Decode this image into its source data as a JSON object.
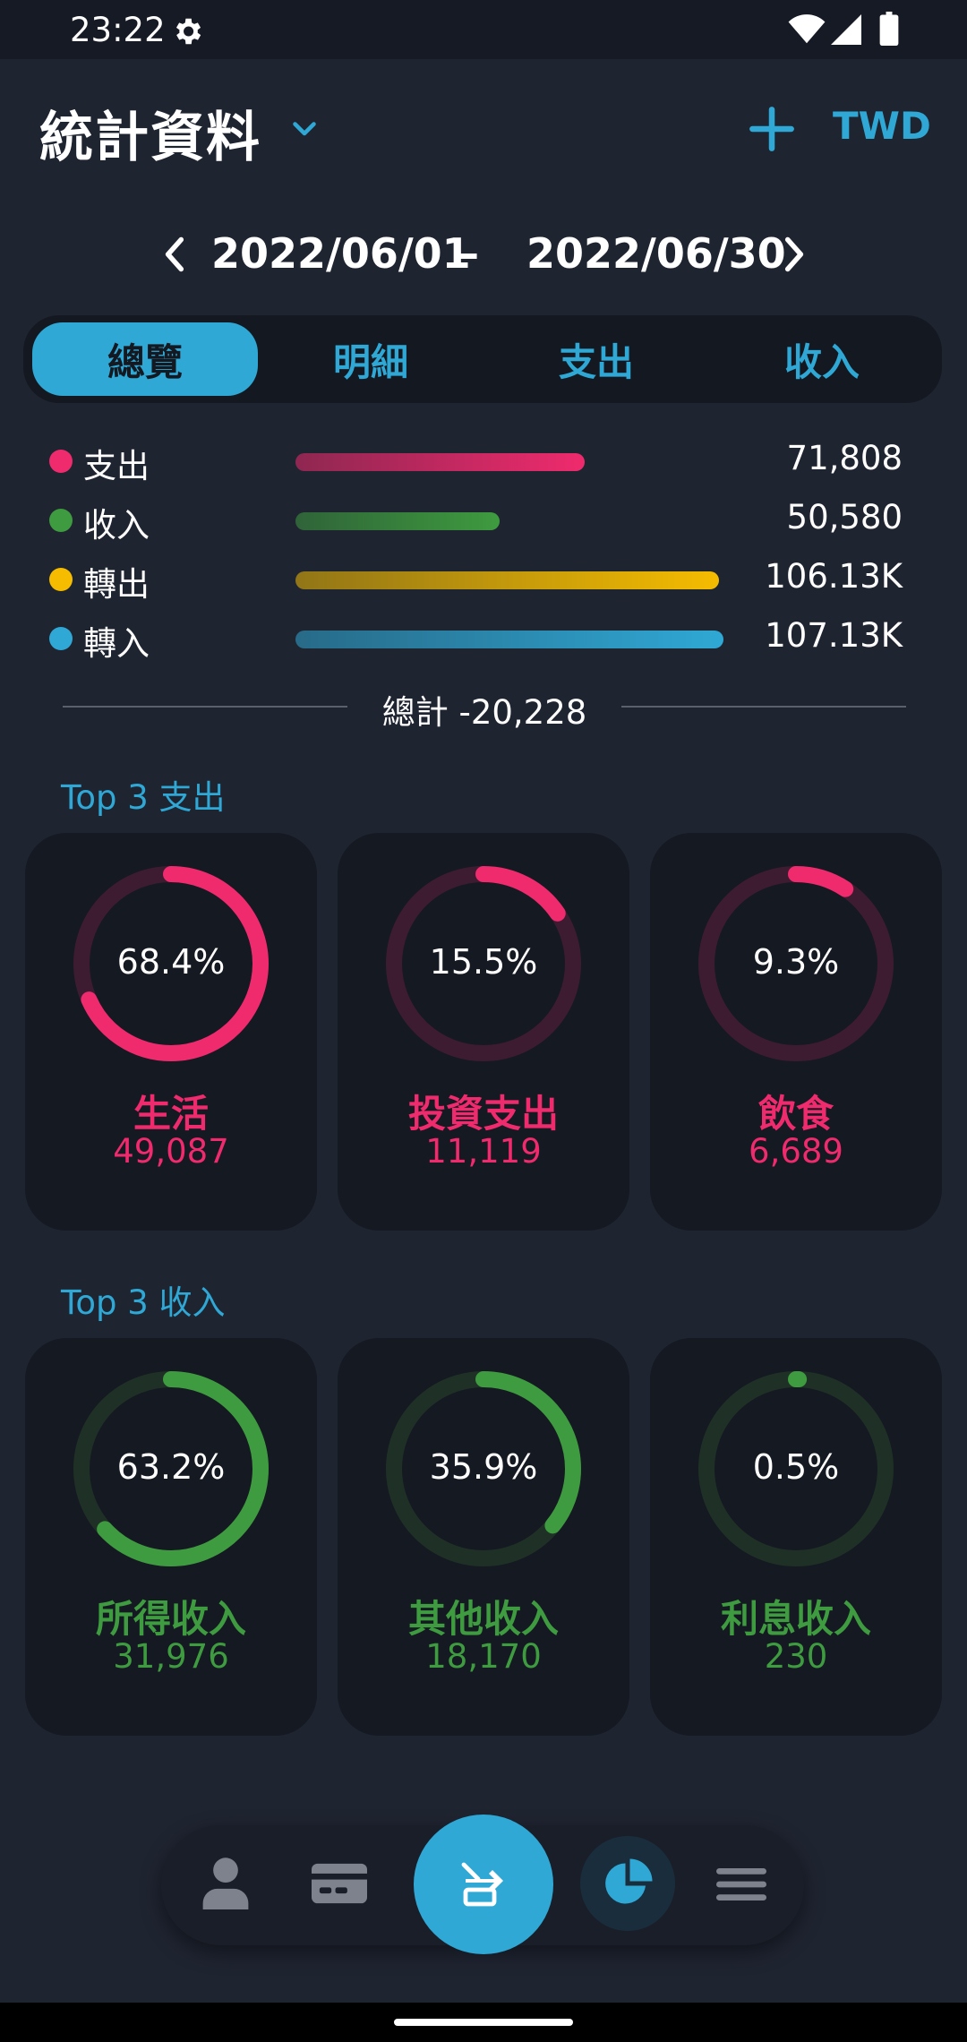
{
  "status_bar": {
    "time": "23:22"
  },
  "header": {
    "title": "統計資料",
    "currency": "TWD"
  },
  "date_range": {
    "start": "2022/06/01",
    "separator": "–",
    "end": "2022/06/30"
  },
  "tabs": [
    {
      "label": "總覽",
      "active": true
    },
    {
      "label": "明細",
      "active": false
    },
    {
      "label": "支出",
      "active": false
    },
    {
      "label": "收入",
      "active": false
    }
  ],
  "summary": [
    {
      "label": "支出",
      "value": "71,808",
      "color": "#ef2a6d",
      "bar_fraction": 0.676
    },
    {
      "label": "收入",
      "value": "50,580",
      "color": "#3e9b3f",
      "bar_fraction": 0.476
    },
    {
      "label": "轉出",
      "value": "106.13K",
      "color": "#f5bc00",
      "bar_fraction": 0.99
    },
    {
      "label": "轉入",
      "value": "107.13K",
      "color": "#2fa8d5",
      "bar_fraction": 1.0
    }
  ],
  "total": {
    "text": "總計 -20,228"
  },
  "top_expense": {
    "title": "Top 3 支出",
    "color": "#ef2a6d",
    "track_color": "#3d1c31",
    "items": [
      {
        "percent_label": "68.4%",
        "fraction": 0.684,
        "name": "生活",
        "amount": "49,087"
      },
      {
        "percent_label": "15.5%",
        "fraction": 0.155,
        "name": "投資支出",
        "amount": "11,119"
      },
      {
        "percent_label": "9.3%",
        "fraction": 0.093,
        "name": "飲食",
        "amount": "6,689"
      }
    ]
  },
  "top_income": {
    "title": "Top 3 收入",
    "color": "#3e9b3f",
    "track_color": "#1f3126",
    "items": [
      {
        "percent_label": "63.2%",
        "fraction": 0.632,
        "name": "所得收入",
        "amount": "31,976"
      },
      {
        "percent_label": "35.9%",
        "fraction": 0.359,
        "name": "其他收入",
        "amount": "18,170"
      },
      {
        "percent_label": "0.5%",
        "fraction": 0.005,
        "name": "利息收入",
        "amount": "230"
      }
    ]
  },
  "bottom_nav": {
    "items": [
      "person-icon",
      "card-icon",
      "transfer-edit-icon",
      "pie-chart-icon",
      "menu-icon"
    ],
    "active": "pie-chart-icon"
  }
}
